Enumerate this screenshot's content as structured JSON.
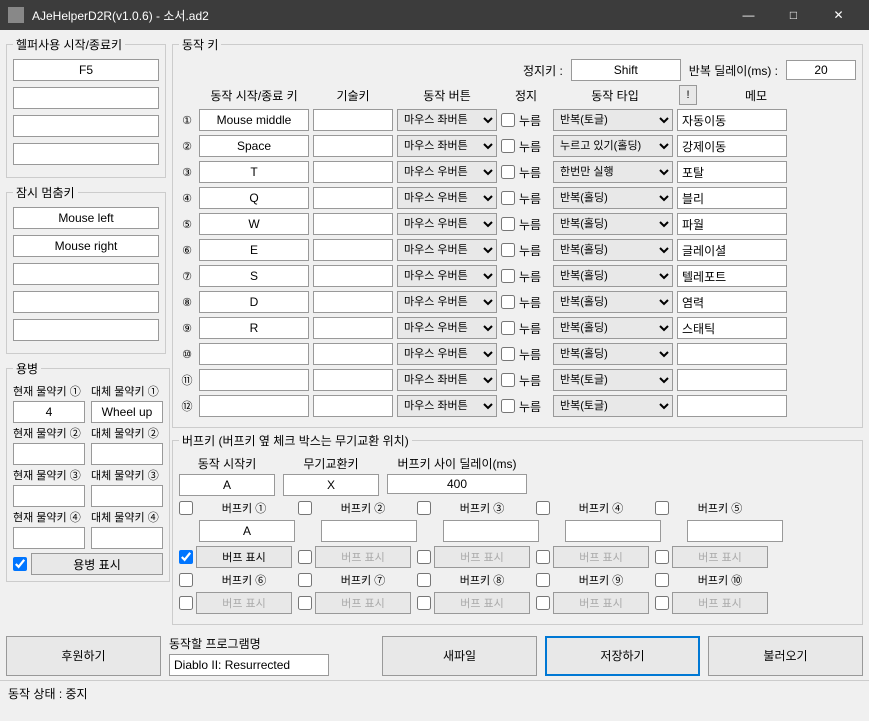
{
  "window": {
    "title": "AJeHelperD2R(v1.0.6) - 소서.ad2"
  },
  "left": {
    "helper_title": "헬퍼사용 시작/종료키",
    "helper_keys": [
      "F5",
      "",
      "",
      ""
    ],
    "pause_title": "잠시 멈춤키",
    "pause_keys": [
      "Mouse left",
      "Mouse right",
      "",
      "",
      ""
    ],
    "merc_title": "용병",
    "merc_labels": {
      "cur1": "현재 물약키 ①",
      "alt1": "대체 물약키 ①",
      "cur2": "현재 물약키 ②",
      "alt2": "대체 물약키 ②",
      "cur3": "현재 물약키 ③",
      "alt3": "대체 물약키 ③",
      "cur4": "현재 물약키 ④",
      "alt4": "대체 물약키 ④"
    },
    "merc_vals": {
      "cur1": "4",
      "alt1": "Wheel up",
      "cur2": "",
      "alt2": "",
      "cur3": "",
      "alt3": "",
      "cur4": "",
      "alt4": ""
    },
    "merc_show": "용병 표시"
  },
  "action": {
    "title": "동작 키",
    "stop_label": "정지키 :",
    "stop_key": "Shift",
    "delay_label": "반복 딜레이(ms) :",
    "delay": "20",
    "headers": {
      "key": "동작 시작/종료 키",
      "skill": "기술키",
      "btn": "동작 버튼",
      "stop": "정지",
      "type": "동작 타입",
      "bang": "!",
      "memo": "메모"
    },
    "rows": [
      {
        "n": "①",
        "key": "Mouse middle",
        "skill": "",
        "btn": "마우스 좌버튼",
        "stop": "누름",
        "type": "반복(토글)",
        "memo": "자동이동"
      },
      {
        "n": "②",
        "key": "Space",
        "skill": "",
        "btn": "마우스 좌버튼",
        "stop": "누름",
        "type": "누르고 있기(홀딩)",
        "memo": "강제이동"
      },
      {
        "n": "③",
        "key": "T",
        "skill": "",
        "btn": "마우스 우버튼",
        "stop": "누름",
        "type": "한번만 실행",
        "memo": "포탈"
      },
      {
        "n": "④",
        "key": "Q",
        "skill": "",
        "btn": "마우스 우버튼",
        "stop": "누름",
        "type": "반복(홀딩)",
        "memo": "블리"
      },
      {
        "n": "⑤",
        "key": "W",
        "skill": "",
        "btn": "마우스 우버튼",
        "stop": "누름",
        "type": "반복(홀딩)",
        "memo": "파월"
      },
      {
        "n": "⑥",
        "key": "E",
        "skill": "",
        "btn": "마우스 우버튼",
        "stop": "누름",
        "type": "반복(홀딩)",
        "memo": "글레이셜"
      },
      {
        "n": "⑦",
        "key": "S",
        "skill": "",
        "btn": "마우스 우버튼",
        "stop": "누름",
        "type": "반복(홀딩)",
        "memo": "텔레포트"
      },
      {
        "n": "⑧",
        "key": "D",
        "skill": "",
        "btn": "마우스 우버튼",
        "stop": "누름",
        "type": "반복(홀딩)",
        "memo": "염력"
      },
      {
        "n": "⑨",
        "key": "R",
        "skill": "",
        "btn": "마우스 우버튼",
        "stop": "누름",
        "type": "반복(홀딩)",
        "memo": "스태틱"
      },
      {
        "n": "⑩",
        "key": "",
        "skill": "",
        "btn": "마우스 우버튼",
        "stop": "누름",
        "type": "반복(홀딩)",
        "memo": ""
      },
      {
        "n": "⑪",
        "key": "",
        "skill": "",
        "btn": "마우스 좌버튼",
        "stop": "누름",
        "type": "반복(토글)",
        "memo": ""
      },
      {
        "n": "⑫",
        "key": "",
        "skill": "",
        "btn": "마우스 좌버튼",
        "stop": "누름",
        "type": "반복(토글)",
        "memo": ""
      }
    ]
  },
  "buff": {
    "title": "버프키 (버프키 옆 체크 박스는 무기교환 위치)",
    "hdr": {
      "start": "동작 시작키",
      "swap": "무기교환키",
      "delay": "버프키 사이 딜레이(ms)"
    },
    "start": "A",
    "swap": "X",
    "delay": "400",
    "labels": [
      "버프키 ①",
      "버프키 ②",
      "버프키 ③",
      "버프키 ④",
      "버프키 ⑤",
      "버프키 ⑥",
      "버프키 ⑦",
      "버프키 ⑧",
      "버프키 ⑨",
      "버프키 ⑩"
    ],
    "vals": [
      "A",
      "",
      "",
      "",
      "",
      "",
      "",
      "",
      "",
      ""
    ],
    "show": "버프 표시"
  },
  "bottom": {
    "sponsor": "후원하기",
    "prog_label": "동작할 프로그램명",
    "prog": "Diablo II: Resurrected",
    "new": "새파일",
    "save": "저장하기",
    "load": "불러오기"
  },
  "status": "동작 상태 : 중지"
}
